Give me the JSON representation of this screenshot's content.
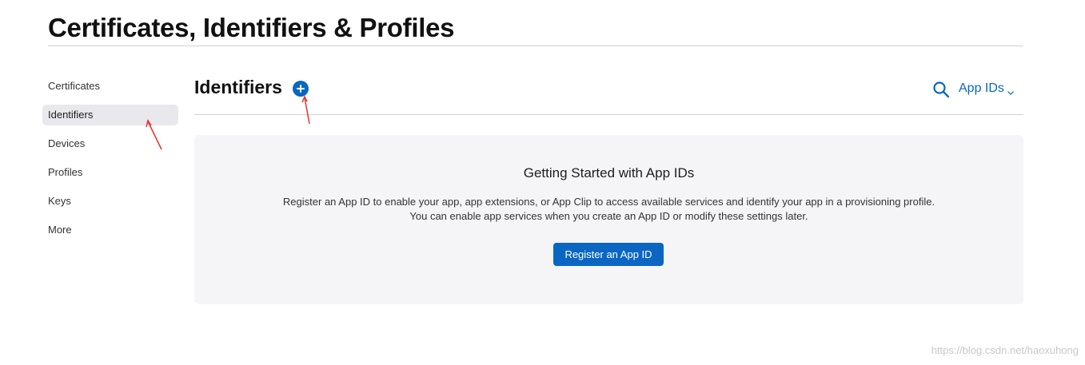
{
  "page": {
    "title": "Certificates, Identifiers & Profiles"
  },
  "sidebar": {
    "items": [
      {
        "label": "Certificates",
        "active": false
      },
      {
        "label": "Identifiers",
        "active": true
      },
      {
        "label": "Devices",
        "active": false
      },
      {
        "label": "Profiles",
        "active": false
      },
      {
        "label": "Keys",
        "active": false
      },
      {
        "label": "More",
        "active": false
      }
    ]
  },
  "section": {
    "title": "Identifiers",
    "add_icon": "plus-circle-icon",
    "search_icon": "search-icon",
    "filter_value": "App IDs",
    "filter_icon": "chevron-down-icon"
  },
  "empty_state": {
    "title": "Getting Started with App IDs",
    "line1": "Register an App ID to enable your app, app extensions, or App Clip to access available services and identify your app in a provisioning profile.",
    "line2": "You can enable app services when you create an App ID or modify these settings later.",
    "button_label": "Register an App ID"
  },
  "watermark": "https://blog.csdn.net/haoxuhong",
  "colors": {
    "accent": "#0a66c2",
    "annotation": "#e8322b",
    "card_bg": "#f5f5f7",
    "active_item_bg": "#e8e8ed"
  }
}
